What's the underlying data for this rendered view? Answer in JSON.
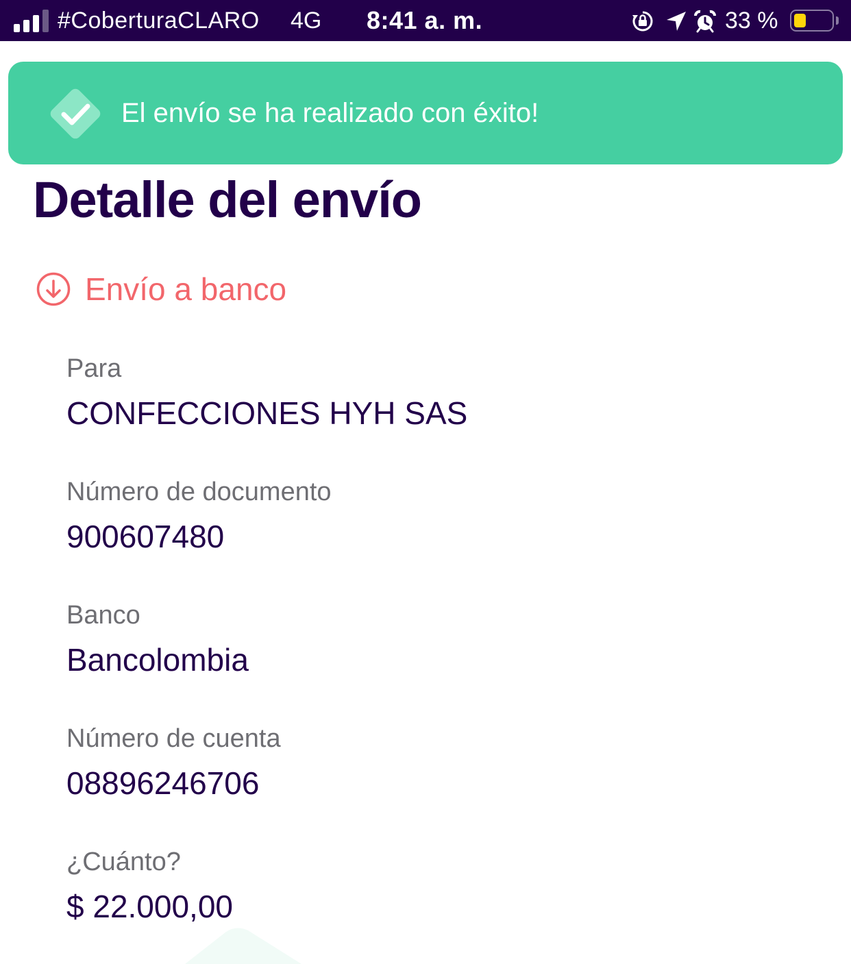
{
  "status_bar": {
    "carrier": "#CoberturaCLARO",
    "network": "4G",
    "time": "8:41 a. m.",
    "battery_percent": "33 %",
    "battery_level": 0.33,
    "signal_bars": 3,
    "icons": [
      "signal-icon",
      "rotation-lock-icon",
      "location-arrow-icon",
      "alarm-clock-icon",
      "battery-icon"
    ],
    "battery_color": "#ffd60a"
  },
  "toast": {
    "message": "El envío se ha realizado con éxito!",
    "icon": "checkmark-icon",
    "background_color": "#45cfa1"
  },
  "page": {
    "title": "Detalle del envío"
  },
  "transfer": {
    "type_label": "Envío a banco",
    "icon": "arrow-down-circle-icon",
    "accent_color": "#f2666b"
  },
  "details": [
    {
      "label": "Para",
      "value": "CONFECCIONES HYH SAS"
    },
    {
      "label": "Número de documento",
      "value": "900607480"
    },
    {
      "label": "Banco",
      "value": "Bancolombia"
    },
    {
      "label": "Número de cuenta",
      "value": "08896246706"
    },
    {
      "label": "¿Cuánto?",
      "value": "$ 22.000,00"
    }
  ],
  "colors": {
    "primary_dark": "#22004a",
    "label_gray": "#6e6e73"
  }
}
